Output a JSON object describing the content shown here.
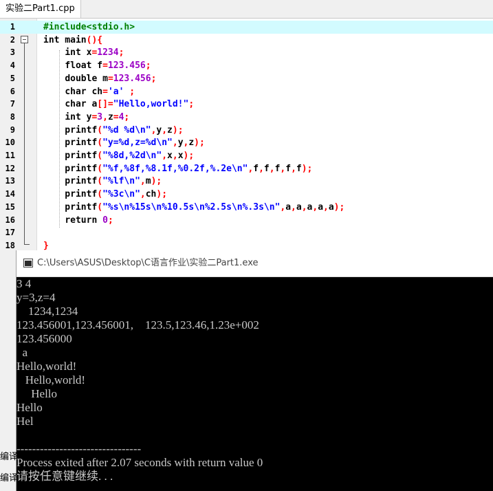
{
  "tab": {
    "label": "实验二Part1.cpp"
  },
  "editor": {
    "lines": [
      {
        "num": "1",
        "html": "<span style=\"color:#008000\">#include&lt;stdio.h&gt;</span>"
      },
      {
        "num": "2",
        "html": "<span style=\"color:#000\">int</span> main<span style=\"color:#ff0000\">()</span><span style=\"color:#ff0000\">{</span>"
      },
      {
        "num": "3",
        "html": "    <span style=\"color:#000\">int</span> x<span style=\"color:#ff0000\">=</span><span style=\"color:#9b00c5\">1234</span><span style=\"color:#ff0000\">;</span>"
      },
      {
        "num": "4",
        "html": "    <span style=\"color:#000\">float</span> f<span style=\"color:#ff0000\">=</span><span style=\"color:#9b00c5\">123.456</span><span style=\"color:#ff0000\">;</span>"
      },
      {
        "num": "5",
        "html": "    <span style=\"color:#000\">double</span> m<span style=\"color:#ff0000\">=</span><span style=\"color:#9b00c5\">123.456</span><span style=\"color:#ff0000\">;</span>"
      },
      {
        "num": "6",
        "html": "    <span style=\"color:#000\">char</span> ch<span style=\"color:#ff0000\">=</span><span style=\"color:#0000ff\">'a'</span> <span style=\"color:#ff0000\">;</span>"
      },
      {
        "num": "7",
        "html": "    <span style=\"color:#000\">char</span> a<span style=\"color:#ff0000\">[]=</span><span style=\"color:#0000ff\">\"Hello,world!\"</span><span style=\"color:#ff0000\">;</span>"
      },
      {
        "num": "8",
        "html": "    <span style=\"color:#000\">int</span> y<span style=\"color:#ff0000\">=</span><span style=\"color:#9b00c5\">3</span><span style=\"color:#ff0000\">,</span>z<span style=\"color:#ff0000\">=</span><span style=\"color:#9b00c5\">4</span><span style=\"color:#ff0000\">;</span>"
      },
      {
        "num": "9",
        "html": "    printf<span style=\"color:#ff0000\">(</span><span style=\"color:#0000ff\">\"%d %d\\n\"</span><span style=\"color:#ff0000\">,</span>y<span style=\"color:#ff0000\">,</span>z<span style=\"color:#ff0000\">);</span>"
      },
      {
        "num": "10",
        "html": "    printf<span style=\"color:#ff0000\">(</span><span style=\"color:#0000ff\">\"y=%d,z=%d\\n\"</span><span style=\"color:#ff0000\">,</span>y<span style=\"color:#ff0000\">,</span>z<span style=\"color:#ff0000\">);</span>"
      },
      {
        "num": "11",
        "html": "    printf<span style=\"color:#ff0000\">(</span><span style=\"color:#0000ff\">\"%8d,%2d\\n\"</span><span style=\"color:#ff0000\">,</span>x<span style=\"color:#ff0000\">,</span>x<span style=\"color:#ff0000\">);</span>"
      },
      {
        "num": "12",
        "html": "    printf<span style=\"color:#ff0000\">(</span><span style=\"color:#0000ff\">\"%f,%8f,%8.1f,%0.2f,%.2e\\n\"</span><span style=\"color:#ff0000\">,</span>f<span style=\"color:#ff0000\">,</span>f<span style=\"color:#ff0000\">,</span>f<span style=\"color:#ff0000\">,</span>f<span style=\"color:#ff0000\">,</span>f<span style=\"color:#ff0000\">);</span>"
      },
      {
        "num": "13",
        "html": "    printf<span style=\"color:#ff0000\">(</span><span style=\"color:#0000ff\">\"%lf\\n\"</span><span style=\"color:#ff0000\">,</span>m<span style=\"color:#ff0000\">);</span>"
      },
      {
        "num": "14",
        "html": "    printf<span style=\"color:#ff0000\">(</span><span style=\"color:#0000ff\">\"%3c\\n\"</span><span style=\"color:#ff0000\">,</span>ch<span style=\"color:#ff0000\">);</span>"
      },
      {
        "num": "15",
        "html": "    printf<span style=\"color:#ff0000\">(</span><span style=\"color:#0000ff\">\"%s\\n%15s\\n%10.5s\\n%2.5s\\n%.3s\\n\"</span><span style=\"color:#ff0000\">,</span>a<span style=\"color:#ff0000\">,</span>a<span style=\"color:#ff0000\">,</span>a<span style=\"color:#ff0000\">,</span>a<span style=\"color:#ff0000\">,</span>a<span style=\"color:#ff0000\">);</span>"
      },
      {
        "num": "16",
        "html": "    <span style=\"color:#000\">return</span> <span style=\"color:#9b00c5\">0</span><span style=\"color:#ff0000\">;</span>"
      },
      {
        "num": "17",
        "html": ""
      },
      {
        "num": "18",
        "html": "<span style=\"color:#ff0000\">}</span>"
      }
    ]
  },
  "console": {
    "title": "C:\\Users\\ASUS\\Desktop\\C语言作业\\实验二Part1.exe",
    "output": [
      "3 4",
      "y=3,z=4",
      "    1234,1234",
      "123.456001,123.456001,    123.5,123.46,1.23e+002",
      "123.456000",
      "  a",
      "Hello,world!",
      "   Hello,world!",
      "     Hello",
      "Hello",
      "Hel",
      "",
      "--------------------------------",
      "Process exited after 2.07 seconds with return value 0",
      "请按任意键继续. . ."
    ]
  },
  "background": {
    "left_labels": [
      "编译",
      "编译"
    ]
  }
}
